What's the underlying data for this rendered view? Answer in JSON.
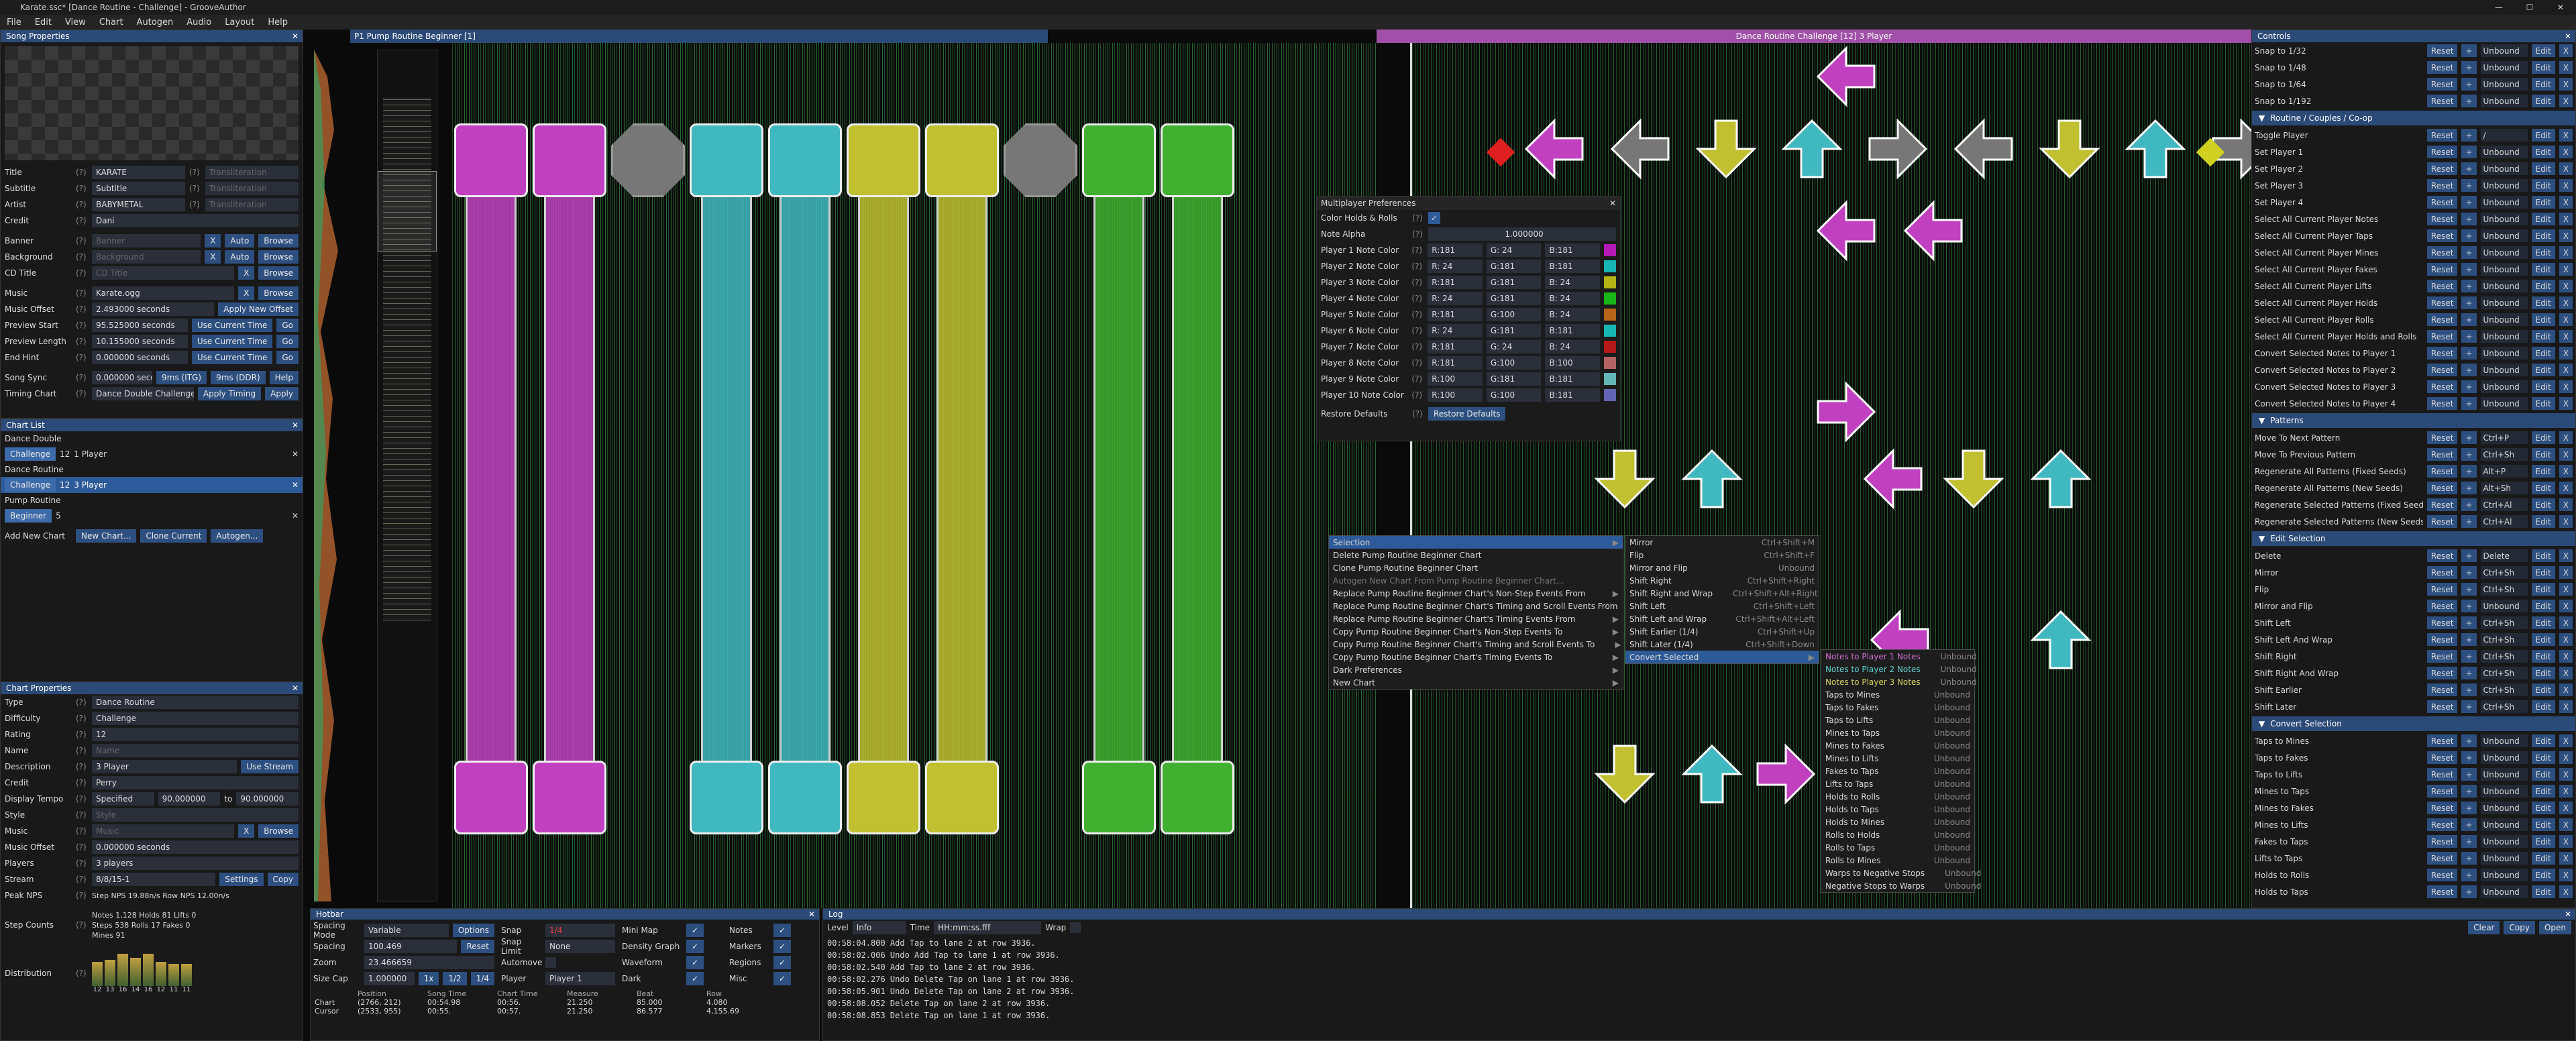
{
  "window": {
    "title": "Karate.ssc* [Dance Routine - Challenge] - GrooveAuthor",
    "min": "—",
    "max": "☐",
    "close": "✕"
  },
  "menu": [
    "File",
    "Edit",
    "View",
    "Chart",
    "Autogen",
    "Audio",
    "Layout",
    "Help"
  ],
  "song_props": {
    "header": "Song Properties",
    "fields": [
      {
        "label": "Title",
        "value": "KARATE",
        "translit": "Transliteration"
      },
      {
        "label": "Subtitle",
        "value": "Subtitle",
        "translit": "Transliteration"
      },
      {
        "label": "Artist",
        "value": "BABYMETAL",
        "translit": "Transliteration"
      },
      {
        "label": "Credit",
        "value": "Dani"
      }
    ],
    "banner": {
      "label": "Banner",
      "placeholder": "Banner",
      "b1": "X",
      "b2": "Auto",
      "b3": "Browse"
    },
    "background": {
      "label": "Background",
      "placeholder": "Background",
      "b1": "X",
      "b2": "Auto",
      "b3": "Browse"
    },
    "cdtitle": {
      "label": "CD Title",
      "placeholder": "CD Title",
      "b1": "X",
      "b3": "Browse"
    },
    "music": {
      "label": "Music",
      "value": "Karate.ogg",
      "b1": "X",
      "b3": "Browse"
    },
    "music_offset": {
      "label": "Music Offset",
      "value": "2.493000 seconds",
      "btn": "Apply New Offset"
    },
    "preview_start": {
      "label": "Preview Start",
      "value": "95.525000 seconds",
      "btn": "Use Current Time",
      "go": "Go"
    },
    "preview_length": {
      "label": "Preview Length",
      "value": "10.155000 seconds",
      "btn": "Use Current Time",
      "go": "Go"
    },
    "end_hint": {
      "label": "End Hint",
      "value": "0.000000 seconds",
      "btn": "Use Current Time",
      "go": "Go"
    },
    "song_sync": {
      "label": "Song Sync",
      "value": "0.000000 seconds",
      "b1": "9ms (ITG)",
      "b2": "9ms (DDR)",
      "b3": "Help"
    },
    "timing_chart": {
      "label": "Timing Chart",
      "value": "Dance Double Challenge",
      "b1": "Apply Timing",
      "b2": "Apply"
    }
  },
  "chart_list": {
    "header": "Chart List",
    "groups": [
      {
        "name": "Dance Double",
        "diff": "Challenge",
        "lvl": "12",
        "desc": "1 Player"
      },
      {
        "name": "Dance Routine",
        "diff": "Challenge",
        "lvl": "12",
        "desc": "3 Player"
      },
      {
        "name": "Pump Routine",
        "diff": "Beginner",
        "lvl": "5",
        "desc": ""
      }
    ],
    "add_label": "Add New Chart",
    "b_new": "New Chart...",
    "b_clone": "Clone Current",
    "b_auto": "Autogen..."
  },
  "chart_props": {
    "header": "Chart Properties",
    "type": {
      "label": "Type",
      "value": "Dance Routine"
    },
    "difficulty": {
      "label": "Difficulty",
      "value": "Challenge"
    },
    "rating": {
      "label": "Rating",
      "value": "12"
    },
    "name": {
      "label": "Name",
      "value": "Name"
    },
    "description": {
      "label": "Description",
      "value": "3 Player",
      "btn": "Use Stream"
    },
    "credit": {
      "label": "Credit",
      "value": "Perry"
    },
    "display_tempo": {
      "label": "Display Tempo",
      "mode": "Specified",
      "v1": "90.000000",
      "to": "to",
      "v2": "90.000000"
    },
    "style": {
      "label": "Style",
      "value": "Style"
    },
    "music": {
      "label": "Music",
      "value": "Music",
      "b1": "X",
      "b2": "Browse"
    },
    "music_offset": {
      "label": "Music Offset",
      "value": "0.000000 seconds"
    },
    "players": {
      "label": "Players",
      "value": "3 players"
    },
    "stream": {
      "label": "Stream",
      "value": "8/8/15-1",
      "b1": "Settings",
      "b2": "Copy"
    },
    "peak_nps": {
      "label": "Peak NPS",
      "value": "Step NPS  19.88n/s   Row NPS  12.00n/s"
    },
    "step_counts": {
      "label": "Step Counts",
      "line1": "Notes  1,128   Holds  81   Lifts  0",
      "line2": "Steps  538   Rolls  17   Fakes  0",
      "line3": "Mines  91"
    },
    "distribution": {
      "label": "Distribution",
      "nums": [
        "12",
        "13",
        "16",
        "14",
        "16",
        "12",
        "11",
        "11"
      ]
    }
  },
  "editor": {
    "header_left": "P1  Pump Routine Beginner [1]",
    "header_right": "Dance Routine Challenge [12] 3 Player"
  },
  "mp_prefs": {
    "header": "Multiplayer Preferences",
    "color_holds": "Color Holds & Rolls",
    "note_alpha": "Note Alpha",
    "alpha_val": "1.000000",
    "players": [
      {
        "label": "Player 1 Note Color",
        "r": "R:181",
        "g": "G: 24",
        "b": "B:181",
        "c": "#b518b5"
      },
      {
        "label": "Player 2 Note Color",
        "r": "R: 24",
        "g": "G:181",
        "b": "B:181",
        "c": "#18b5b5"
      },
      {
        "label": "Player 3 Note Color",
        "r": "R:181",
        "g": "G:181",
        "b": "B: 24",
        "c": "#b5b518"
      },
      {
        "label": "Player 4 Note Color",
        "r": "R: 24",
        "g": "G:181",
        "b": "B: 24",
        "c": "#18b518"
      },
      {
        "label": "Player 5 Note Color",
        "r": "R:181",
        "g": "G:100",
        "b": "B: 24",
        "c": "#b56418"
      },
      {
        "label": "Player 6 Note Color",
        "r": "R: 24",
        "g": "G:181",
        "b": "B:181",
        "c": "#18b5b5"
      },
      {
        "label": "Player 7 Note Color",
        "r": "R:181",
        "g": "G: 24",
        "b": "B: 24",
        "c": "#b51818"
      },
      {
        "label": "Player 8 Note Color",
        "r": "R:181",
        "g": "G:100",
        "b": "B:100",
        "c": "#b56464"
      },
      {
        "label": "Player 9 Note Color",
        "r": "R:100",
        "g": "G:181",
        "b": "B:181",
        "c": "#64b5b5"
      },
      {
        "label": "Player 10 Note Color",
        "r": "R:100",
        "g": "G:100",
        "b": "B:181",
        "c": "#6464b5"
      }
    ],
    "restore": "Restore Defaults",
    "restore_btn": "Restore Defaults"
  },
  "ctx_main": [
    {
      "t": "Selection",
      "arrow": "▶",
      "sel": true
    },
    {
      "t": "Delete Pump Routine Beginner Chart"
    },
    {
      "t": "Clone Pump Routine Beginner Chart"
    },
    {
      "t": "Autogen New Chart From Pump Routine Beginner Chart...",
      "dim": true
    },
    {
      "t": "Replace Pump Routine Beginner Chart's Non-Step Events From",
      "arrow": "▶"
    },
    {
      "t": "Replace Pump Routine Beginner Chart's Timing and Scroll Events From",
      "arrow": "▶"
    },
    {
      "t": "Replace Pump Routine Beginner Chart's Timing Events From",
      "arrow": "▶"
    },
    {
      "t": "Copy Pump Routine Beginner Chart's Non-Step Events To",
      "arrow": "▶"
    },
    {
      "t": "Copy Pump Routine Beginner Chart's Timing and Scroll Events To",
      "arrow": "▶"
    },
    {
      "t": "Copy Pump Routine Beginner Chart's Timing Events To",
      "arrow": "▶"
    },
    {
      "t": "Dark Preferences",
      "arrow": "▶"
    },
    {
      "t": "New Chart",
      "arrow": "▶"
    }
  ],
  "ctx_sel": [
    {
      "t": "Mirror",
      "sc": "Ctrl+Shift+M"
    },
    {
      "t": "Flip",
      "sc": "Ctrl+Shift+F"
    },
    {
      "t": "Mirror and Flip",
      "sc": "Unbound"
    },
    {
      "t": "Shift Right",
      "sc": "Ctrl+Shift+Right"
    },
    {
      "t": "Shift Right and Wrap",
      "sc": "Ctrl+Shift+Alt+Right"
    },
    {
      "t": "Shift Left",
      "sc": "Ctrl+Shift+Left"
    },
    {
      "t": "Shift Left and Wrap",
      "sc": "Ctrl+Shift+Alt+Left"
    },
    {
      "t": "Shift Earlier (1/4)",
      "sc": "Ctrl+Shift+Up"
    },
    {
      "t": "Shift Later (1/4)",
      "sc": "Ctrl+Shift+Down"
    },
    {
      "t": "Convert Selected",
      "sc": "▶",
      "sel": true
    }
  ],
  "ctx_conv": [
    {
      "t": "Notes to Player 1 Notes",
      "sc": "Unbound",
      "c": "#d070d0"
    },
    {
      "t": "Notes to Player 2 Notes",
      "sc": "Unbound",
      "c": "#60d0d0"
    },
    {
      "t": "Notes to Player 3 Notes",
      "sc": "Unbound",
      "c": "#d0d060"
    },
    {
      "t": "Taps to Mines",
      "sc": "Unbound"
    },
    {
      "t": "Taps to Fakes",
      "sc": "Unbound"
    },
    {
      "t": "Taps to Lifts",
      "sc": "Unbound"
    },
    {
      "t": "Mines to Taps",
      "sc": "Unbound"
    },
    {
      "t": "Mines to Fakes",
      "sc": "Unbound"
    },
    {
      "t": "Mines to Lifts",
      "sc": "Unbound"
    },
    {
      "t": "Fakes to Taps",
      "sc": "Unbound"
    },
    {
      "t": "Lifts to Taps",
      "sc": "Unbound"
    },
    {
      "t": "Holds to Rolls",
      "sc": "Unbound"
    },
    {
      "t": "Holds to Taps",
      "sc": "Unbound"
    },
    {
      "t": "Holds to Mines",
      "sc": "Unbound"
    },
    {
      "t": "Rolls to Holds",
      "sc": "Unbound"
    },
    {
      "t": "Rolls to Taps",
      "sc": "Unbound"
    },
    {
      "t": "Rolls to Mines",
      "sc": "Unbound"
    },
    {
      "t": "Warps to Negative Stops",
      "sc": "Unbound"
    },
    {
      "t": "Negative Stops to Warps",
      "sc": "Unbound"
    }
  ],
  "controls": {
    "header": "Controls",
    "top": [
      {
        "n": "Snap to 1/32",
        "k": "Unbound"
      },
      {
        "n": "Snap to 1/48",
        "k": "Unbound"
      },
      {
        "n": "Snap to 1/64",
        "k": "Unbound"
      },
      {
        "n": "Snap to 1/192",
        "k": "Unbound"
      }
    ],
    "sections": [
      {
        "h": "Routine / Couples / Co-op",
        "items": [
          {
            "n": "Toggle Player",
            "k": "/"
          },
          {
            "n": "Set Player 1",
            "k": "Unbound"
          },
          {
            "n": "Set Player 2",
            "k": "Unbound"
          },
          {
            "n": "Set Player 3",
            "k": "Unbound"
          },
          {
            "n": "Set Player 4",
            "k": "Unbound"
          },
          {
            "n": "Select All Current Player Notes",
            "k": "Unbound"
          },
          {
            "n": "Select All Current Player Taps",
            "k": "Unbound"
          },
          {
            "n": "Select All Current Player Mines",
            "k": "Unbound"
          },
          {
            "n": "Select All Current Player Fakes",
            "k": "Unbound"
          },
          {
            "n": "Select All Current Player Lifts",
            "k": "Unbound"
          },
          {
            "n": "Select All Current Player Holds",
            "k": "Unbound"
          },
          {
            "n": "Select All Current Player Rolls",
            "k": "Unbound"
          },
          {
            "n": "Select All Current Player Holds and Rolls",
            "k": "Unbound"
          },
          {
            "n": "Convert Selected Notes to Player 1",
            "k": "Unbound"
          },
          {
            "n": "Convert Selected Notes to Player 2",
            "k": "Unbound"
          },
          {
            "n": "Convert Selected Notes to Player 3",
            "k": "Unbound"
          },
          {
            "n": "Convert Selected Notes to Player 4",
            "k": "Unbound"
          }
        ]
      },
      {
        "h": "Patterns",
        "items": [
          {
            "n": "Move To Next Pattern",
            "k": "Ctrl+P"
          },
          {
            "n": "Move To Previous Pattern",
            "k": "Ctrl+Sh"
          },
          {
            "n": "Regenerate All Patterns (Fixed Seeds)",
            "k": "Alt+P"
          },
          {
            "n": "Regenerate All Patterns (New Seeds)",
            "k": "Alt+Sh"
          },
          {
            "n": "Regenerate Selected Patterns (Fixed Seeds)",
            "k": "Ctrl+Al"
          },
          {
            "n": "Regenerate Selected Patterns (New Seeds)",
            "k": "Ctrl+Al"
          }
        ]
      },
      {
        "h": "Edit Selection",
        "items": [
          {
            "n": "Delete",
            "k": "Delete"
          },
          {
            "n": "Mirror",
            "k": "Ctrl+Sh"
          },
          {
            "n": "Flip",
            "k": "Ctrl+Sh"
          },
          {
            "n": "Mirror and Flip",
            "k": "Unbound"
          },
          {
            "n": "Shift Left",
            "k": "Ctrl+Sh"
          },
          {
            "n": "Shift Left And Wrap",
            "k": "Ctrl+Sh"
          },
          {
            "n": "Shift Right",
            "k": "Ctrl+Sh"
          },
          {
            "n": "Shift Right And Wrap",
            "k": "Ctrl+Sh"
          },
          {
            "n": "Shift Earlier",
            "k": "Ctrl+Sh"
          },
          {
            "n": "Shift Later",
            "k": "Ctrl+Sh"
          }
        ]
      },
      {
        "h": "Convert Selection",
        "items": [
          {
            "n": "Taps to Mines",
            "k": "Unbound"
          },
          {
            "n": "Taps to Fakes",
            "k": "Unbound"
          },
          {
            "n": "Taps to Lifts",
            "k": "Unbound"
          },
          {
            "n": "Mines to Taps",
            "k": "Unbound"
          },
          {
            "n": "Mines to Fakes",
            "k": "Unbound"
          },
          {
            "n": "Mines to Lifts",
            "k": "Unbound"
          },
          {
            "n": "Fakes to Taps",
            "k": "Unbound"
          },
          {
            "n": "Lifts to Taps",
            "k": "Unbound"
          },
          {
            "n": "Holds to Rolls",
            "k": "Unbound"
          },
          {
            "n": "Holds to Taps",
            "k": "Unbound"
          }
        ]
      }
    ],
    "reset": "Reset",
    "plus": "+",
    "edit": "Edit",
    "x": "X"
  },
  "hotbar": {
    "header": "Hotbar",
    "spacing_mode": "Spacing Mode",
    "spacing_mode_v": "Variable",
    "options": "Options",
    "spacing": "Spacing",
    "spacing_v": "100.469",
    "reset": "Reset",
    "zoom": "Zoom",
    "zoom_v": "23.466659",
    "size_cap": "Size Cap",
    "size_cap_v": "1.000000",
    "one": "1x",
    "half": "1/2",
    "quarter": "1/4",
    "snap": "Snap",
    "snap_v": "1/4",
    "step_limit": "Snap Limit",
    "step_limit_v": "None",
    "automove": "Automove",
    "player": "Player",
    "player_v": "Player 1",
    "mini_map": "Mini Map",
    "density": "Density Graph",
    "waveform": "Waveform",
    "dark": "Dark",
    "notes": "Notes",
    "markers": "Markers",
    "regions": "Regions",
    "misc": "Misc",
    "pos_hdr": [
      "Position",
      "Song Time",
      "Chart Time",
      "Measure",
      "Beat",
      "Row"
    ],
    "chart_row": [
      "Chart",
      "(2766, 212)",
      "00:54.98",
      "00:56.",
      "21.250",
      "85.000",
      "4,080"
    ],
    "cursor_row": [
      "Cursor",
      "(2533, 955)",
      "00:55.",
      "00:57.",
      "21.250",
      "86.577",
      "4,155.69"
    ]
  },
  "log": {
    "header": "Log",
    "level": "Level",
    "level_v": "Info",
    "time": "Time",
    "time_v": "HH:mm:ss.fff",
    "wrap": "Wrap",
    "lines": [
      "00:58:04.800 Add Tap to lane 2 at row 3936.",
      "00:58:02.006 Undo Add Tap to lane 1 at row 3936.",
      "00:58:02.540 Add Tap to lane 2 at row 3936.",
      "00:58:02.276 Undo Delete Tap on lane 1 at row 3936.",
      "00:58:05.901 Undo Delete Tap on lane 2 at row 3936.",
      "00:58:08.052 Delete Tap on lane 2 at row 3936.",
      "00:58:08.853 Delete Tap on lane 1 at row 3936."
    ],
    "clear": "Clear",
    "copy": "Copy",
    "open": "Open"
  },
  "colors": {
    "accent": "#2d4f80",
    "p1": "#c040c0",
    "p2": "#40b8c0",
    "p3": "#c0c030",
    "p4": "#40b030",
    "grey": "#777777"
  }
}
